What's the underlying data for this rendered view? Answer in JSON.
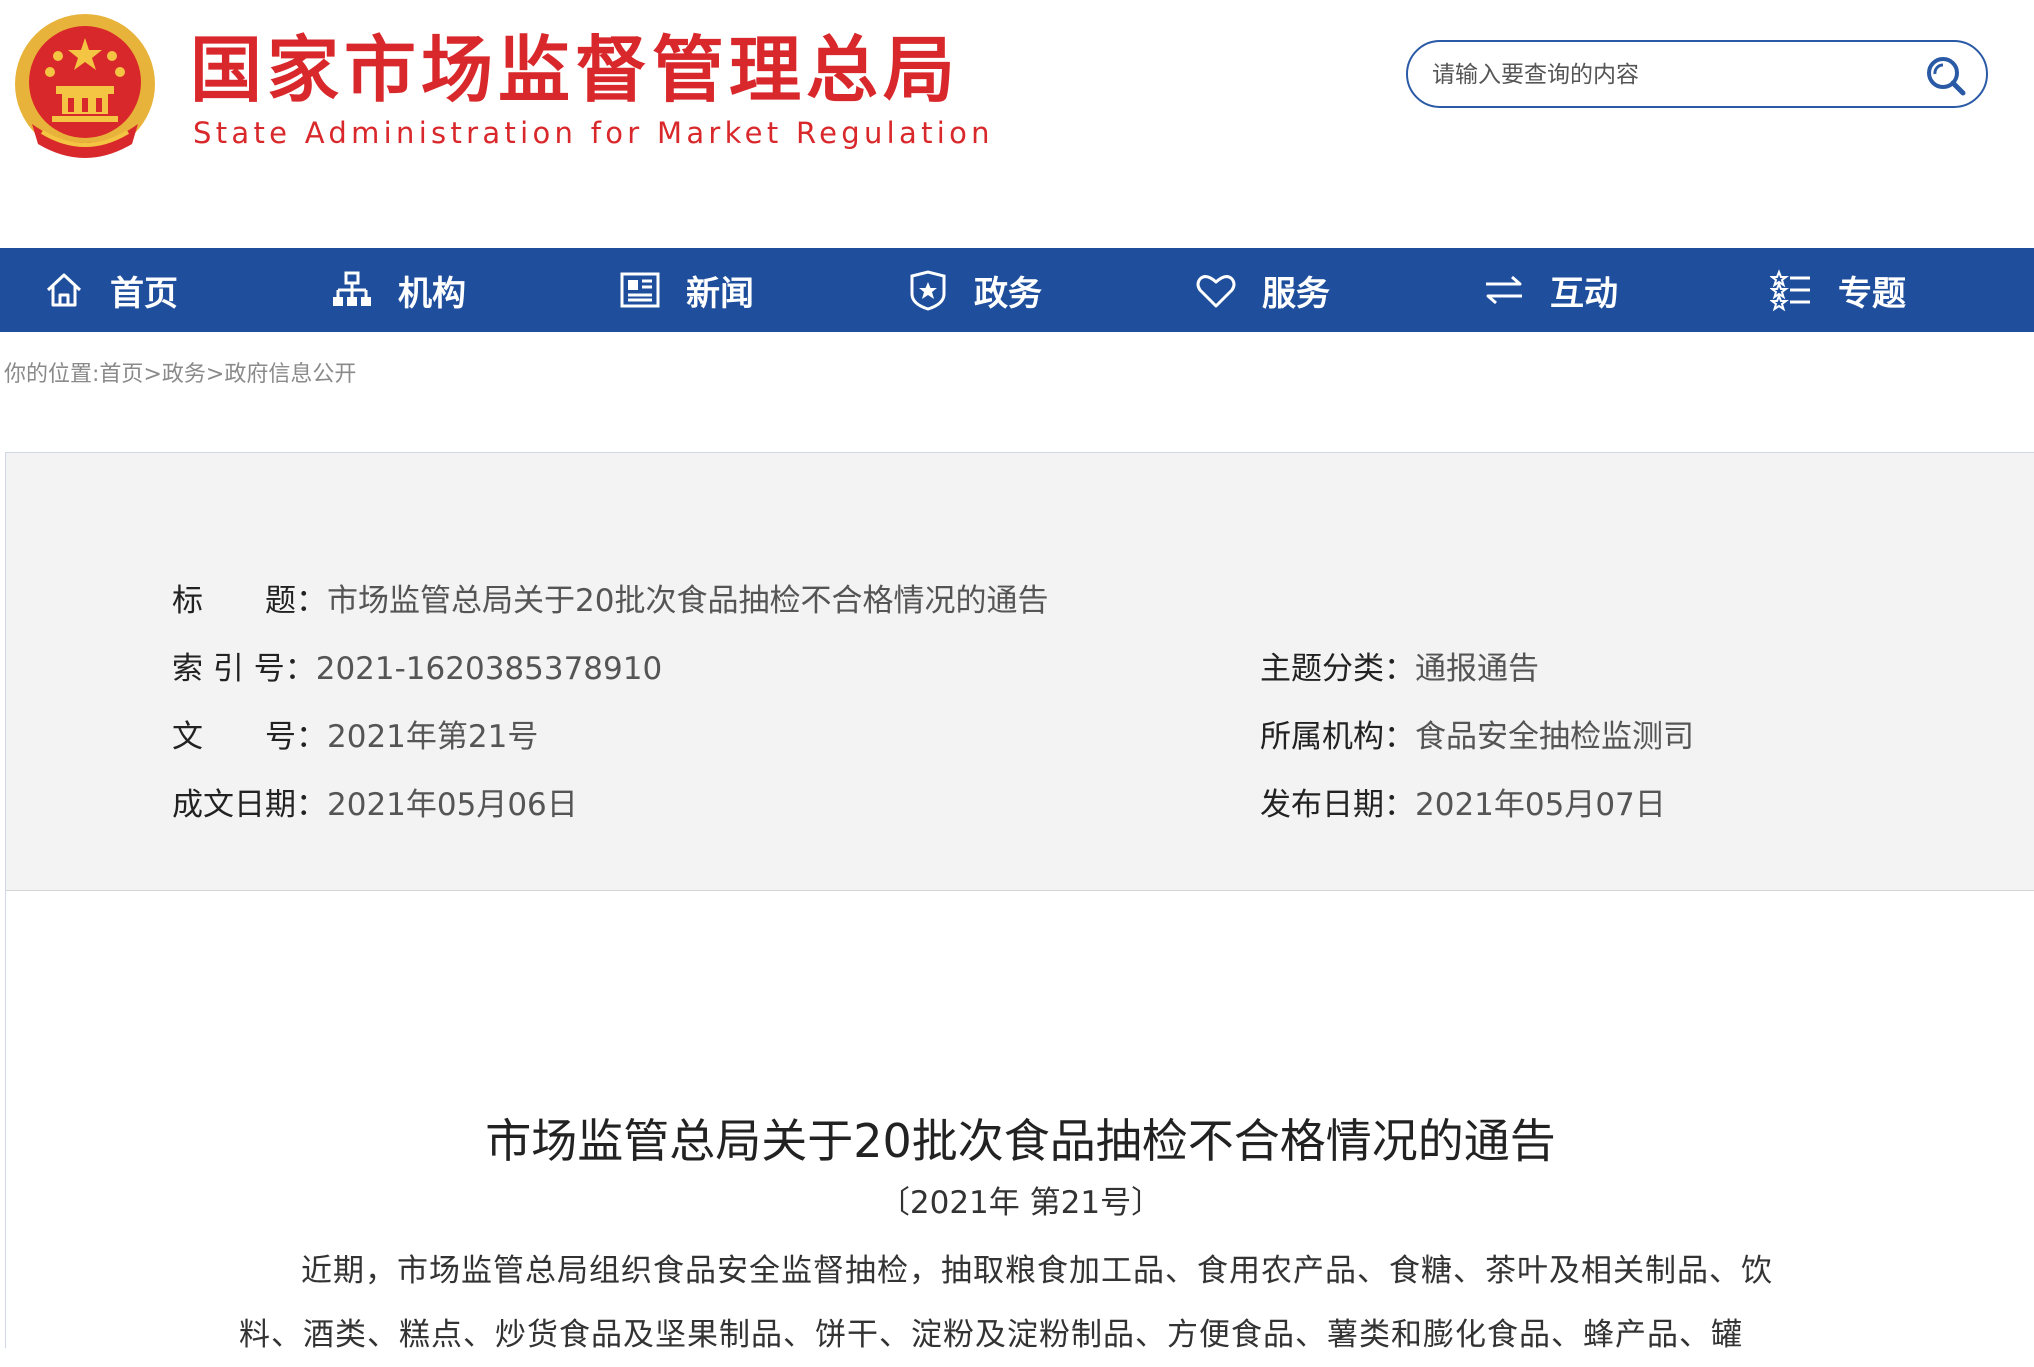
{
  "header": {
    "title_cn": "国家市场监督管理总局",
    "title_en": "State Administration for Market Regulation",
    "search_placeholder": "请输入要查询的内容"
  },
  "nav": {
    "items": [
      {
        "label": "首页",
        "icon": "home-icon"
      },
      {
        "label": "机构",
        "icon": "org-chart-icon"
      },
      {
        "label": "新闻",
        "icon": "newspaper-icon"
      },
      {
        "label": "政务",
        "icon": "shield-icon"
      },
      {
        "label": "服务",
        "icon": "heart-icon"
      },
      {
        "label": "互动",
        "icon": "exchange-arrows-icon"
      },
      {
        "label": "专题",
        "icon": "topics-list-icon"
      }
    ]
  },
  "breadcrumb": {
    "prefix": "你的位置:",
    "items": [
      "首页",
      "政务",
      "政府信息公开"
    ],
    "separator": ">"
  },
  "meta": {
    "title_label": "标　　题：",
    "title_value": "市场监管总局关于20批次食品抽检不合格情况的通告",
    "index_label": "索 引 号：",
    "index_value": "2021-1620385378910",
    "topic_label": "主题分类：",
    "topic_value": "通报通告",
    "docno_label": "文　　号：",
    "docno_value": "2021年第21号",
    "org_label": "所属机构：",
    "org_value": "食品安全抽检监测司",
    "written_label": "成文日期：",
    "written_value": "2021年05月06日",
    "publish_label": "发布日期：",
    "publish_value": "2021年05月07日"
  },
  "article": {
    "title": "市场监管总局关于20批次食品抽检不合格情况的通告",
    "number": "〔2021年 第21号〕",
    "body": "近期，市场监管总局组织食品安全监督抽检，抽取粮食加工品、食用农产品、食糖、茶叶及相关制品、饮料、酒类、糕点、炒货食品及坚果制品、饼干、淀粉及淀粉制品、方便食品、薯类和膨化食品、蜂产品、罐"
  },
  "colors": {
    "brand_red": "#d9282b",
    "nav_blue": "#1e4e9c",
    "meta_bg": "#f3f3f3"
  }
}
